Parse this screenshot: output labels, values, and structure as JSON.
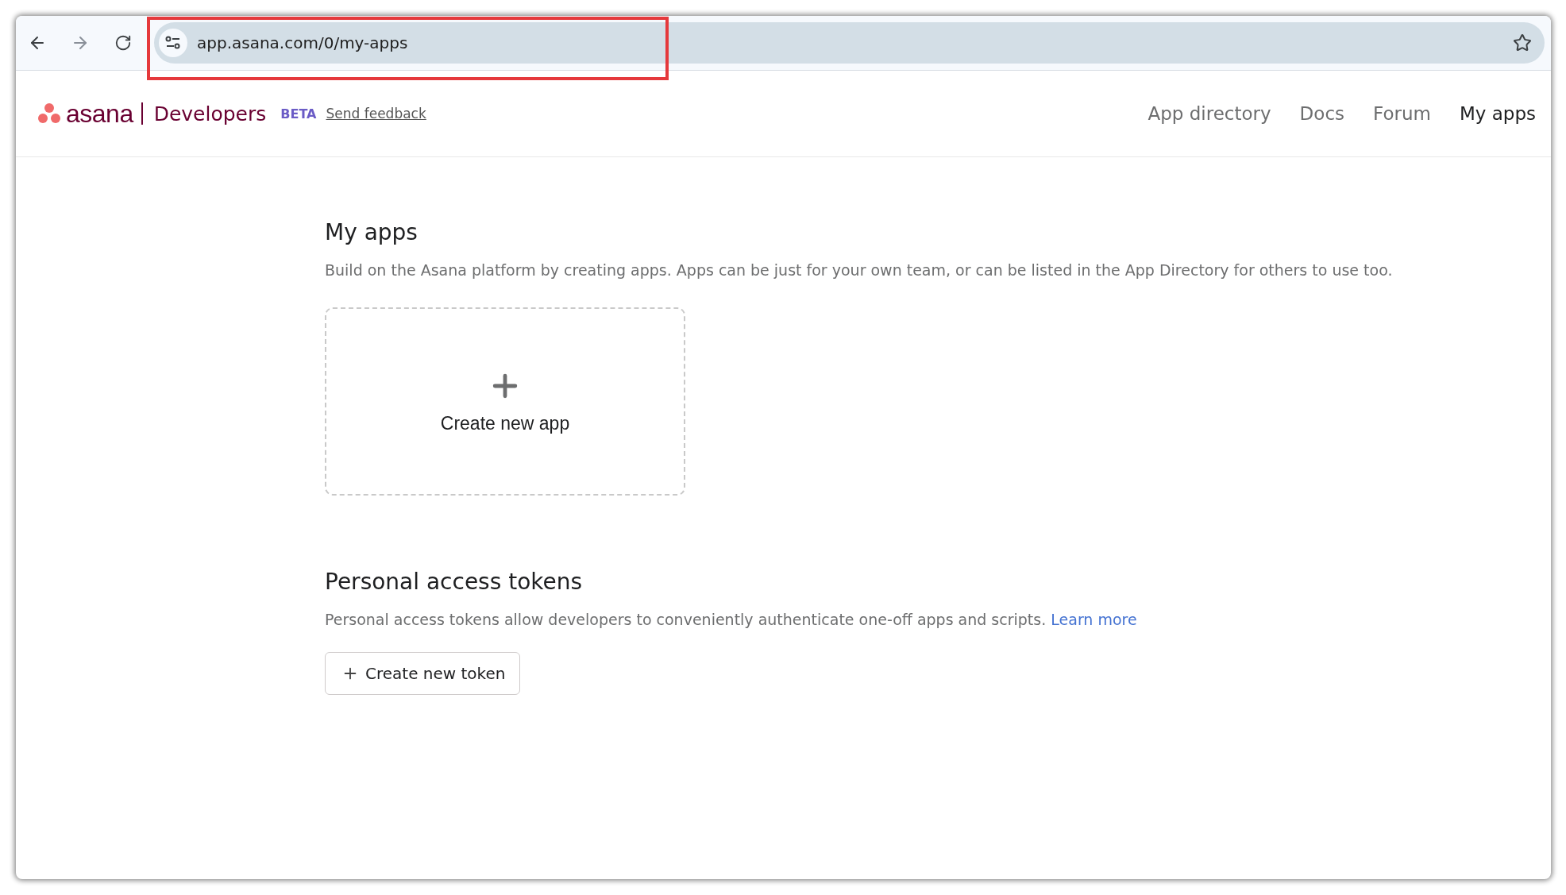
{
  "browser": {
    "url": "app.asana.com/0/my-apps"
  },
  "header": {
    "logo": "asana",
    "product": "Developers",
    "badge": "BETA",
    "feedback_link": "Send feedback",
    "nav": [
      {
        "label": "App directory",
        "selected": false
      },
      {
        "label": "Docs",
        "selected": false
      },
      {
        "label": "Forum",
        "selected": false
      },
      {
        "label": "My apps",
        "selected": true
      }
    ]
  },
  "my_apps": {
    "title": "My apps",
    "description": "Build on the Asana platform by creating apps. Apps can be just for your own team, or can be listed in the App Directory for others to use too.",
    "create_card": "Create new app"
  },
  "tokens": {
    "title": "Personal access tokens",
    "description": "Personal access tokens allow developers to conveniently authenticate one-off apps and scripts.",
    "learn_more": "Learn more",
    "create_button": "Create new token"
  }
}
